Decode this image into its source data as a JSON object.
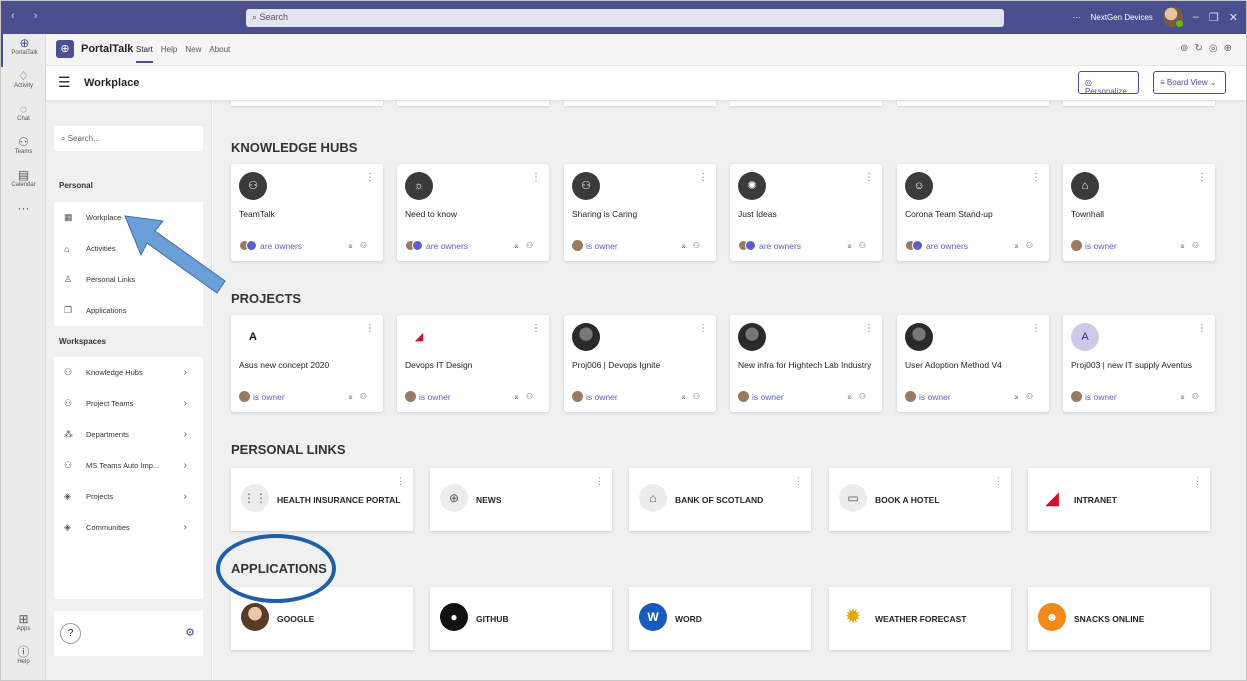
{
  "titlebar": {
    "search_placeholder": "Search",
    "org": "NextGen Devices",
    "more": "···"
  },
  "rail": [
    {
      "label": "PortalTalk",
      "icon": "portal-icon",
      "glyph": "⊕"
    },
    {
      "label": "Activity",
      "icon": "bell-icon",
      "glyph": "♫"
    },
    {
      "label": "Chat",
      "icon": "chat-icon",
      "glyph": "☺"
    },
    {
      "label": "Teams",
      "icon": "teams-icon",
      "glyph": "⚇"
    },
    {
      "label": "Calendar",
      "icon": "calendar-icon",
      "glyph": "▤"
    },
    {
      "label": "",
      "icon": "more-icon",
      "glyph": "···"
    }
  ],
  "rail_bottom": [
    {
      "label": "Apps",
      "icon": "apps-icon",
      "glyph": "⊞"
    },
    {
      "label": "Help",
      "icon": "help-icon",
      "glyph": "?"
    }
  ],
  "appbar": {
    "name": "PortalTalk",
    "tabs": [
      "Start",
      "Help",
      "New",
      "About"
    ]
  },
  "header": {
    "title": "Workplace",
    "personalize": "Personalize",
    "board_view": "Board View"
  },
  "sidebar": {
    "search_placeholder": "Search...",
    "personal_heading": "Personal",
    "personal": [
      {
        "label": "Workplace",
        "icon": "grid-icon"
      },
      {
        "label": "Activities",
        "icon": "home-icon"
      },
      {
        "label": "Personal Links",
        "icon": "person-icon"
      },
      {
        "label": "Applications",
        "icon": "copy-icon"
      }
    ],
    "workspaces_heading": "Workspaces",
    "workspaces": [
      {
        "label": "Knowledge Hubs",
        "icon": "teams-icon"
      },
      {
        "label": "Project Teams",
        "icon": "teams-icon"
      },
      {
        "label": "Departments",
        "icon": "org-icon"
      },
      {
        "label": "MS Teams Auto Imp...",
        "icon": "teams-icon"
      },
      {
        "label": "Projects",
        "icon": "project-icon"
      },
      {
        "label": "Communities",
        "icon": "community-icon"
      }
    ]
  },
  "sections": {
    "knowledge_hubs": "KNOWLEDGE HUBS",
    "projects": "PROJECTS",
    "personal_links": "PERSONAL LINKS",
    "applications": "APPLICATIONS"
  },
  "knowledge_hubs": [
    {
      "name": "TeamTalk",
      "owner": "are owners",
      "icon": "group-icon"
    },
    {
      "name": "Need to know",
      "owner": "are owners",
      "icon": "lightbulb-icon"
    },
    {
      "name": "Sharing is Caring",
      "owner": "is owner",
      "icon": "group-icon"
    },
    {
      "name": "Just Ideas",
      "owner": "are owners",
      "icon": "idea-icon"
    },
    {
      "name": "Corona Team Stand-up",
      "owner": "are owners",
      "icon": "face-icon"
    },
    {
      "name": "Townhall",
      "owner": "is owner",
      "icon": "building-icon"
    }
  ],
  "projects": [
    {
      "name": "Asus new concept 2020",
      "owner": "is owner",
      "icon": "asus-logo-icon"
    },
    {
      "name": "Devops IT Design",
      "owner": "is owner",
      "icon": "rog-logo-icon"
    },
    {
      "name": "Proj006 | Devops Ignite",
      "owner": "is owner",
      "icon": "project-image-icon"
    },
    {
      "name": "New infra for Hightech Lab Industry",
      "owner": "is owner",
      "icon": "project-image-icon"
    },
    {
      "name": "User Adoption Method V4",
      "owner": "is owner",
      "icon": "project-image-icon"
    },
    {
      "name": "Proj003 | new IT supply Aventus",
      "owner": "is owner",
      "icon": "letter-a-icon",
      "letter": "A"
    }
  ],
  "personal_links": [
    {
      "name": "HEALTH INSURANCE PORTAL",
      "icon": "dots-grid-icon"
    },
    {
      "name": "NEWS",
      "icon": "globe-icon"
    },
    {
      "name": "BANK OF SCOTLAND",
      "icon": "bank-icon"
    },
    {
      "name": "BOOK A HOTEL",
      "icon": "browser-icon"
    },
    {
      "name": "INTRANET",
      "icon": "rog-logo-icon"
    }
  ],
  "applications": [
    {
      "name": "GOOGLE",
      "icon": "google-avatar-icon"
    },
    {
      "name": "GITHUB",
      "icon": "github-icon"
    },
    {
      "name": "WORD",
      "icon": "word-icon"
    },
    {
      "name": "WEATHER FORECAST",
      "icon": "weather-icon"
    },
    {
      "name": "SNACKS ONLINE",
      "icon": "snacks-icon"
    }
  ],
  "colors": {
    "accent": "#4b4e8f",
    "link": "#5b5fc7",
    "annotation": "#1f5fa8",
    "arrow": "#6a9fd8"
  }
}
